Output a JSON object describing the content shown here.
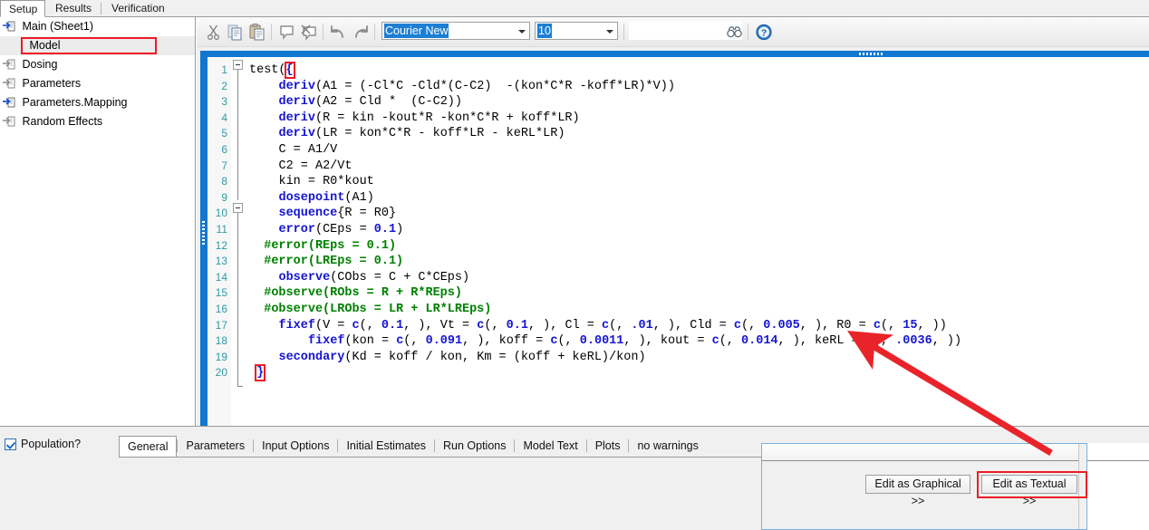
{
  "window": {
    "top_tabs": [
      {
        "label": "Setup",
        "active": true
      },
      {
        "label": "Results",
        "active": false
      },
      {
        "label": "Verification",
        "active": false
      }
    ]
  },
  "sidebar": {
    "items": [
      {
        "label": "Main (Sheet1)",
        "icon": "sheet-arrow-icon",
        "icon_color": "#1b4fcd",
        "selected": false,
        "highlighted": false
      },
      {
        "label": "Model",
        "icon": "none",
        "icon_color": "",
        "selected": true,
        "highlighted": true
      },
      {
        "label": "Dosing",
        "icon": "sheet-arrow-icon",
        "icon_color": "#8a8a8a",
        "selected": false,
        "highlighted": false
      },
      {
        "label": "Parameters",
        "icon": "sheet-arrow-icon",
        "icon_color": "#8a8a8a",
        "selected": false,
        "highlighted": false
      },
      {
        "label": "Parameters.Mapping",
        "icon": "sheet-arrow-icon",
        "icon_color": "#1b4fcd",
        "selected": false,
        "highlighted": false
      },
      {
        "label": "Random Effects",
        "icon": "sheet-arrow-icon",
        "icon_color": "#8a8a8a",
        "selected": false,
        "highlighted": false
      }
    ]
  },
  "toolbar": {
    "buttons": [
      {
        "name": "cut-icon",
        "tip": "Cut"
      },
      {
        "name": "copy-icon",
        "tip": "Copy"
      },
      {
        "name": "paste-icon",
        "tip": "Paste"
      },
      {
        "name": "comment-icon",
        "tip": "Comment"
      },
      {
        "name": "uncomment-icon",
        "tip": "Uncomment"
      },
      {
        "name": "undo-icon",
        "tip": "Undo"
      },
      {
        "name": "redo-icon",
        "tip": "Redo"
      },
      {
        "name": "find-icon",
        "tip": "Find"
      },
      {
        "name": "help-icon",
        "tip": "Help"
      }
    ],
    "font_name": "Courier New",
    "font_size": "10"
  },
  "editor": {
    "first_line": 1,
    "last_line": 20,
    "fold_markers": [
      1,
      10
    ],
    "lines": [
      {
        "n": "1",
        "indent": 0,
        "tokens": [
          {
            "t": "test(",
            "c": "pl"
          },
          {
            "t": "{",
            "c": "brace-hl"
          }
        ]
      },
      {
        "n": "2",
        "indent": 4,
        "tokens": [
          {
            "t": "deriv",
            "c": "kw"
          },
          {
            "t": "(A1 = (-Cl*C -Cld*(C-C2)  -(kon*C*R -koff*LR)*V))",
            "c": "pl"
          }
        ]
      },
      {
        "n": "3",
        "indent": 4,
        "tokens": [
          {
            "t": "deriv",
            "c": "kw"
          },
          {
            "t": "(A2 = Cld *  (C-C2))",
            "c": "pl"
          }
        ]
      },
      {
        "n": "4",
        "indent": 4,
        "tokens": [
          {
            "t": "deriv",
            "c": "kw"
          },
          {
            "t": "(R = kin -kout*R -kon*C*R + koff*LR)",
            "c": "pl"
          }
        ]
      },
      {
        "n": "5",
        "indent": 4,
        "tokens": [
          {
            "t": "deriv",
            "c": "kw"
          },
          {
            "t": "(LR = kon*C*R - koff*LR - keRL*LR)",
            "c": "pl"
          }
        ]
      },
      {
        "n": "6",
        "indent": 4,
        "tokens": [
          {
            "t": "C = A1/V",
            "c": "pl"
          }
        ]
      },
      {
        "n": "7",
        "indent": 4,
        "tokens": [
          {
            "t": "C2 = A2/Vt",
            "c": "pl"
          }
        ]
      },
      {
        "n": "8",
        "indent": 4,
        "tokens": [
          {
            "t": "kin = R0*kout",
            "c": "pl"
          }
        ]
      },
      {
        "n": "9",
        "indent": 4,
        "tokens": [
          {
            "t": "dosepoint",
            "c": "kw"
          },
          {
            "t": "(A1)",
            "c": "pl"
          }
        ]
      },
      {
        "n": "10",
        "indent": 4,
        "tokens": [
          {
            "t": "sequence",
            "c": "kw"
          },
          {
            "t": "{R = R0}",
            "c": "pl"
          }
        ]
      },
      {
        "n": "11",
        "indent": 4,
        "tokens": [
          {
            "t": "error",
            "c": "kw"
          },
          {
            "t": "(CEps = ",
            "c": "pl"
          },
          {
            "t": "0.1",
            "c": "num"
          },
          {
            "t": ")",
            "c": "pl"
          }
        ]
      },
      {
        "n": "12",
        "indent": 2,
        "tokens": [
          {
            "t": "#error(REps = 0.1)",
            "c": "cm"
          }
        ]
      },
      {
        "n": "13",
        "indent": 2,
        "tokens": [
          {
            "t": "#error(LREps = 0.1)",
            "c": "cm"
          }
        ]
      },
      {
        "n": "14",
        "indent": 4,
        "tokens": [
          {
            "t": "observe",
            "c": "kw"
          },
          {
            "t": "(CObs = C + C*CEps)",
            "c": "pl"
          }
        ]
      },
      {
        "n": "15",
        "indent": 2,
        "tokens": [
          {
            "t": "#observe(RObs = R + R*REps)",
            "c": "cm"
          }
        ]
      },
      {
        "n": "16",
        "indent": 2,
        "tokens": [
          {
            "t": "#observe(LRObs = LR + LR*LREps)",
            "c": "cm"
          }
        ]
      },
      {
        "n": "17",
        "indent": 4,
        "tokens": [
          {
            "t": "fixef",
            "c": "kw"
          },
          {
            "t": "(V = ",
            "c": "pl"
          },
          {
            "t": "c",
            "c": "kw"
          },
          {
            "t": "(, ",
            "c": "pl"
          },
          {
            "t": "0.1",
            "c": "num"
          },
          {
            "t": ", ), Vt = ",
            "c": "pl"
          },
          {
            "t": "c",
            "c": "kw"
          },
          {
            "t": "(, ",
            "c": "pl"
          },
          {
            "t": "0.1",
            "c": "num"
          },
          {
            "t": ", ), Cl = ",
            "c": "pl"
          },
          {
            "t": "c",
            "c": "kw"
          },
          {
            "t": "(, ",
            "c": "pl"
          },
          {
            "t": ".01",
            "c": "num"
          },
          {
            "t": ", ), Cld = ",
            "c": "pl"
          },
          {
            "t": "c",
            "c": "kw"
          },
          {
            "t": "(, ",
            "c": "pl"
          },
          {
            "t": "0.005",
            "c": "num"
          },
          {
            "t": ", ), R0 = ",
            "c": "pl"
          },
          {
            "t": "c",
            "c": "kw"
          },
          {
            "t": "(, ",
            "c": "pl"
          },
          {
            "t": "15",
            "c": "num"
          },
          {
            "t": ", ))",
            "c": "pl"
          }
        ]
      },
      {
        "n": "18",
        "indent": 8,
        "tokens": [
          {
            "t": "fixef",
            "c": "kw"
          },
          {
            "t": "(kon = ",
            "c": "pl"
          },
          {
            "t": "c",
            "c": "kw"
          },
          {
            "t": "(, ",
            "c": "pl"
          },
          {
            "t": "0.091",
            "c": "num"
          },
          {
            "t": ", ), koff = ",
            "c": "pl"
          },
          {
            "t": "c",
            "c": "kw"
          },
          {
            "t": "(, ",
            "c": "pl"
          },
          {
            "t": "0.0011",
            "c": "num"
          },
          {
            "t": ", ), kout = ",
            "c": "pl"
          },
          {
            "t": "c",
            "c": "kw"
          },
          {
            "t": "(, ",
            "c": "pl"
          },
          {
            "t": "0.014",
            "c": "num"
          },
          {
            "t": ", ), keRL = ",
            "c": "pl"
          },
          {
            "t": "c",
            "c": "kw"
          },
          {
            "t": "(, ",
            "c": "pl"
          },
          {
            "t": ".0036",
            "c": "num"
          },
          {
            "t": ", ))",
            "c": "pl"
          }
        ]
      },
      {
        "n": "19",
        "indent": 4,
        "tokens": [
          {
            "t": "secondary",
            "c": "kw"
          },
          {
            "t": "(Kd = koff / kon, Km = (koff + keRL)/kon)",
            "c": "pl"
          }
        ]
      },
      {
        "n": "20",
        "indent": 1,
        "tokens": [
          {
            "t": "}",
            "c": "brace-hl"
          }
        ]
      }
    ]
  },
  "bottom": {
    "population_label": "Population?",
    "population_checked": true,
    "tabs": [
      {
        "label": "General",
        "active": true
      },
      {
        "label": "Parameters",
        "active": false
      },
      {
        "label": "Input Options",
        "active": false
      },
      {
        "label": "Initial Estimates",
        "active": false
      },
      {
        "label": "Run Options",
        "active": false
      },
      {
        "label": "Model Text",
        "active": false
      },
      {
        "label": "Plots",
        "active": false
      },
      {
        "label": "no warnings",
        "active": false
      }
    ],
    "edit_graphical_label": "Edit as Graphical >>",
    "edit_textual_label": "Edit as Textual >>"
  },
  "annotation": {
    "highlight_color": "#ee1c25",
    "arrow_color": "#e8242a",
    "arrow_target": "Edit as Textual >>"
  }
}
